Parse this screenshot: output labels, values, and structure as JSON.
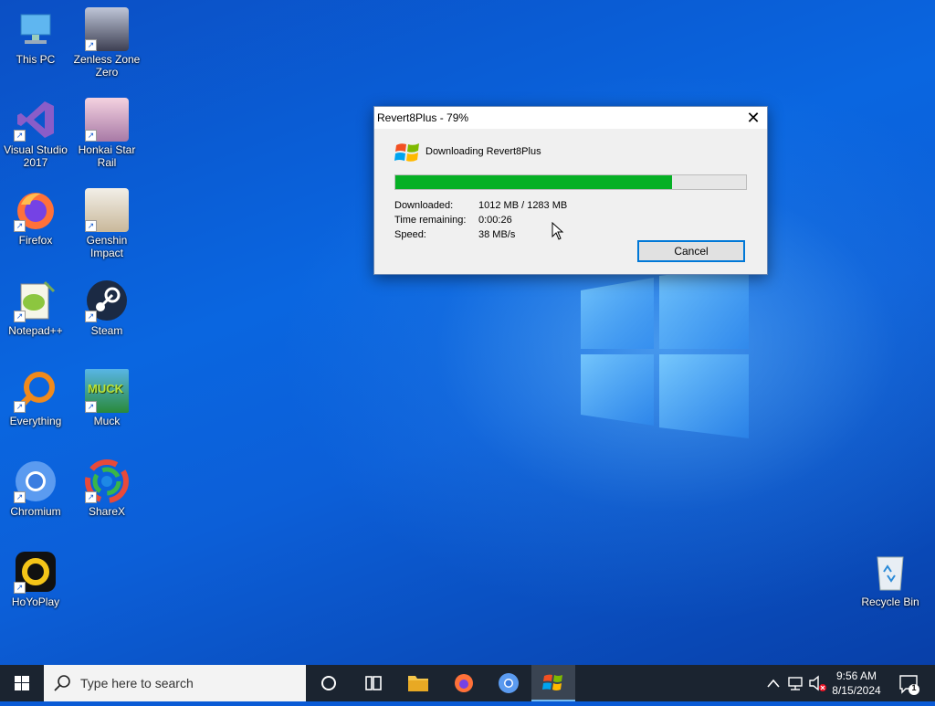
{
  "desktop": {
    "icons": [
      {
        "label": "This PC"
      },
      {
        "label": "Zenless Zone Zero"
      },
      {
        "label": "Visual Studio 2017"
      },
      {
        "label": "Honkai Star Rail"
      },
      {
        "label": "Firefox"
      },
      {
        "label": "Genshin Impact"
      },
      {
        "label": "Notepad++"
      },
      {
        "label": "Steam"
      },
      {
        "label": "Everything"
      },
      {
        "label": "Muck"
      },
      {
        "label": "Chromium"
      },
      {
        "label": "ShareX"
      },
      {
        "label": "HoYoPlay"
      },
      {
        "label": "Recycle Bin"
      }
    ],
    "muck_logo_text": "MUCK"
  },
  "dialog": {
    "title": "Revert8Plus - 79%",
    "close_glyph": "✕",
    "heading": "Downloading Revert8Plus",
    "progress_fraction": 0.79,
    "stats": [
      {
        "key": "Downloaded:",
        "value": "1012 MB / 1283 MB"
      },
      {
        "key": "Time remaining:",
        "value": "0:00:26"
      },
      {
        "key": "Speed:",
        "value": "38 MB/s"
      }
    ],
    "cancel_label": "Cancel"
  },
  "taskbar": {
    "search_placeholder": "Type here to search",
    "time": "9:56 AM",
    "date": "8/15/2024",
    "notification_count": "1"
  },
  "colors": {
    "progress_fill": "#06b025",
    "accent": "#0078d7",
    "taskbar_bg": "#1b2430"
  }
}
